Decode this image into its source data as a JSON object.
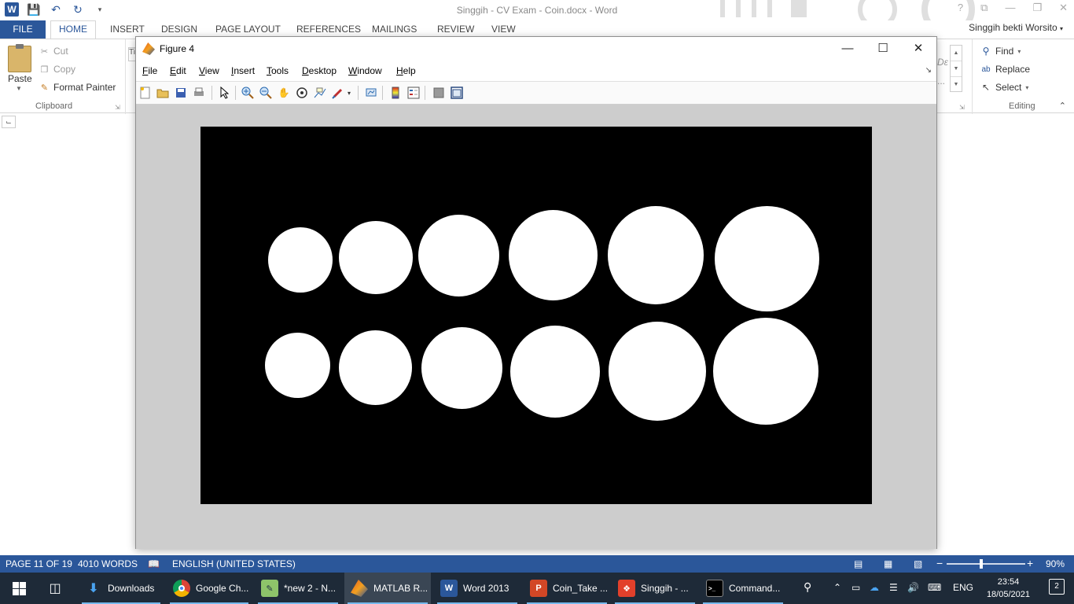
{
  "word": {
    "title": "Singgih - CV Exam - Coin.docx - Word",
    "logo_letter": "W",
    "title_buttons": [
      "?",
      "⧉",
      "—",
      "❐",
      "✕"
    ],
    "tabs": {
      "file": "FILE",
      "home": "HOME",
      "insert": "INSERT",
      "design": "DESIGN",
      "page_layout": "PAGE LAYOUT",
      "references": "REFERENCES",
      "mailings": "MAILINGS",
      "review": "REVIEW",
      "view": "VIEW"
    },
    "user": "Singgih bekti Worsito",
    "clipboard": {
      "paste": "Paste",
      "cut": "Cut",
      "copy": "Copy",
      "format_painter": "Format Painter",
      "group_label": "Clipboard"
    },
    "editing": {
      "find": "Find",
      "replace": "Replace",
      "select": "Select",
      "group_label": "Editing"
    },
    "styles_snip_1": "Dε",
    "styles_snip_2": "...",
    "font_box_snip": "Ti"
  },
  "figure": {
    "title": "Figure 4",
    "menu": [
      "File",
      "Edit",
      "View",
      "Insert",
      "Tools",
      "Desktop",
      "Window",
      "Help"
    ],
    "buttons": {
      "minimize": "—",
      "maximize": "☐",
      "close": "✕"
    },
    "toolbar_icons": [
      "new-figure-icon",
      "open-file-icon",
      "save-icon",
      "print-icon",
      "pointer-icon",
      "zoom-in-icon",
      "zoom-out-icon",
      "pan-icon",
      "rotate-3d-icon",
      "data-cursor-icon",
      "brush-icon",
      "link-plot-icon",
      "colorbar-icon",
      "legend-icon",
      "hide-plot-tools-icon",
      "show-plot-tools-icon"
    ],
    "image_colors": {
      "background": "#000000",
      "foreground": "#ffffff"
    },
    "coin_count_row1": 6,
    "coin_count_row2": 6
  },
  "statusbar": {
    "page": "PAGE 11 OF 19",
    "words": "4010 WORDS",
    "language": "ENGLISH (UNITED STATES)",
    "zoom": "90%",
    "zoom_level": 0.9
  },
  "taskbar": {
    "items": [
      {
        "label": "Downloads",
        "icon": "download-arrow-icon"
      },
      {
        "label": "Google Ch...",
        "icon": "chrome-icon"
      },
      {
        "label": "*new 2 - N...",
        "icon": "notepad-icon"
      },
      {
        "label": "MATLAB R...",
        "icon": "matlab-icon"
      },
      {
        "label": "Word 2013",
        "icon": "word-icon"
      },
      {
        "label": "Coin_Take ...",
        "icon": "powerpoint-icon"
      },
      {
        "label": "Singgih - ...",
        "icon": "pdf-icon"
      },
      {
        "label": "Command...",
        "icon": "cmd-icon"
      }
    ],
    "lang": "ENG",
    "time": "23:54",
    "date": "18/05/2021",
    "notifications": "2"
  }
}
